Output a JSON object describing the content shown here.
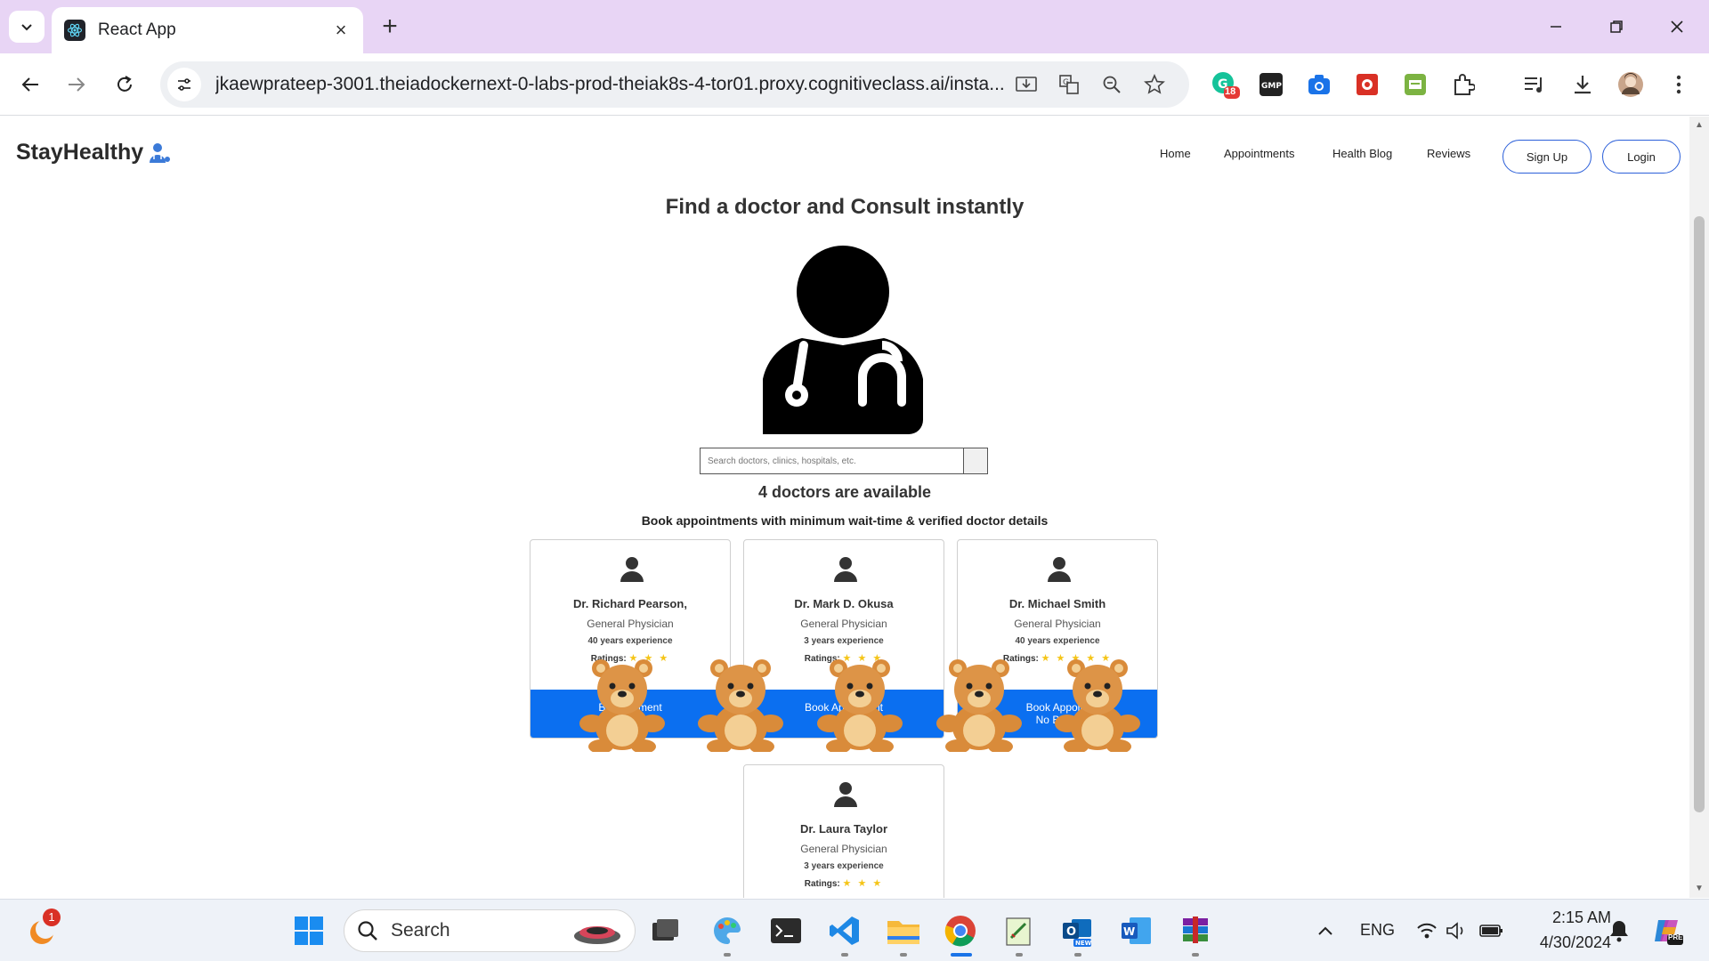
{
  "browser": {
    "tab_title": "React App",
    "url": "jkaewprateep-3001.theiadockernext-0-labs-prod-theiak8s-4-tor01.proxy.cognitiveclass.ai/insta...",
    "extension_badge": "18"
  },
  "site": {
    "logo": "StayHealthy",
    "nav": [
      "Home",
      "Appointments",
      "Health Blog",
      "Reviews"
    ],
    "signup_label": "Sign Up",
    "login_label": "Login"
  },
  "main": {
    "title": "Find a doctor and Consult instantly",
    "search_placeholder": "Search doctors, clinics, hospitals, etc.",
    "available_text": "4 doctors are available",
    "subtitle": "Book appointments with minimum wait-time & verified doctor details"
  },
  "doctors": [
    {
      "name": "Dr. Richard Pearson,",
      "specialty": "General Physician",
      "experience": "40 years experience",
      "ratings_label": "Ratings:",
      "stars": 3,
      "stars_text": "★ ★ ★",
      "book_line1": "Book Appointment",
      "book_line2": "No Booking Fee",
      "visible_line1": "Boo      tment",
      "visible_line2": "           e"
    },
    {
      "name": "Dr. Mark D. Okusa",
      "specialty": "General Physician",
      "experience": "3 years experience",
      "ratings_label": "Ratings:",
      "stars": 3,
      "stars_text": "★ ★ ★",
      "visible_line1": "Book Ap          nt",
      "visible_line2": "No"
    },
    {
      "name": "Dr. Michael Smith",
      "specialty": "General Physician",
      "experience": "40 years experience",
      "ratings_label": "Ratings:",
      "stars": 5,
      "stars_text": "★ ★ ★ ★ ★",
      "visible_line1": "Book Appoint",
      "visible_line2": "No Booki"
    },
    {
      "name": "Dr. Laura Taylor",
      "specialty": "General Physician",
      "experience": "3 years experience",
      "ratings_label": "Ratings:",
      "stars": 3,
      "stars_text": "★ ★ ★"
    }
  ],
  "taskbar": {
    "search_label": "Search",
    "notification_badge": "1",
    "lang": "ENG",
    "time": "2:15 AM",
    "date": "4/30/2024",
    "copilot_badge": "PRE"
  }
}
